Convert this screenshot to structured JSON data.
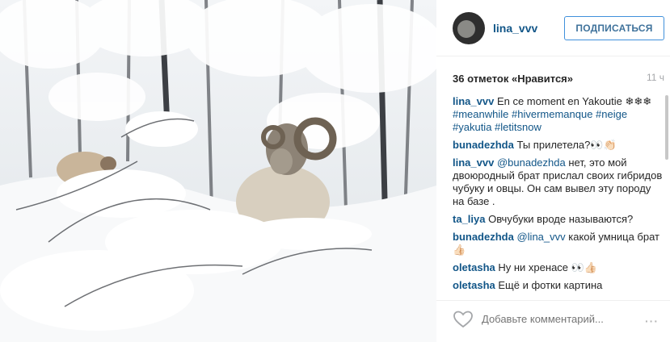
{
  "post": {
    "username": "lina_vvv",
    "follow_label": "ПОДПИСАТЬСЯ",
    "likes_text": "36 отметок «Нравится»",
    "time_text": "11 ч"
  },
  "comments": [
    {
      "author": "lina_vvv",
      "text": "En ce moment en Yakoutie ❄❄❄",
      "tags": "#meanwhile #hivermemanque #neige #yakutia #letitsnow"
    },
    {
      "author": "bunadezhda",
      "text": "Ты прилетела?👀👏🏻"
    },
    {
      "author": "lina_vvv",
      "mention": "@bunadezhda",
      "text": "нет, это мой двоюродный брат прислал своих гибридов чубуку и овцы. Он сам вывел эту породу на базе ."
    },
    {
      "author": "ta_liya",
      "text": "Овчубуки вроде называются?"
    },
    {
      "author": "bunadezhda",
      "mention": "@lina_vvv",
      "text": "какой умница брат👍🏻"
    },
    {
      "author": "oletasha",
      "text": "Ну ни хренасе 👀👍🏻"
    },
    {
      "author": "oletasha",
      "text": "Ещё и фотки картина"
    }
  ],
  "footer": {
    "add_comment_placeholder": "Добавьте комментарий...",
    "more_label": "···"
  },
  "icons": {
    "heart": "heart-icon",
    "more": "more-options-icon"
  },
  "colors": {
    "link": "#125688",
    "follow_border": "#4090db",
    "muted": "#a5a7aa"
  }
}
